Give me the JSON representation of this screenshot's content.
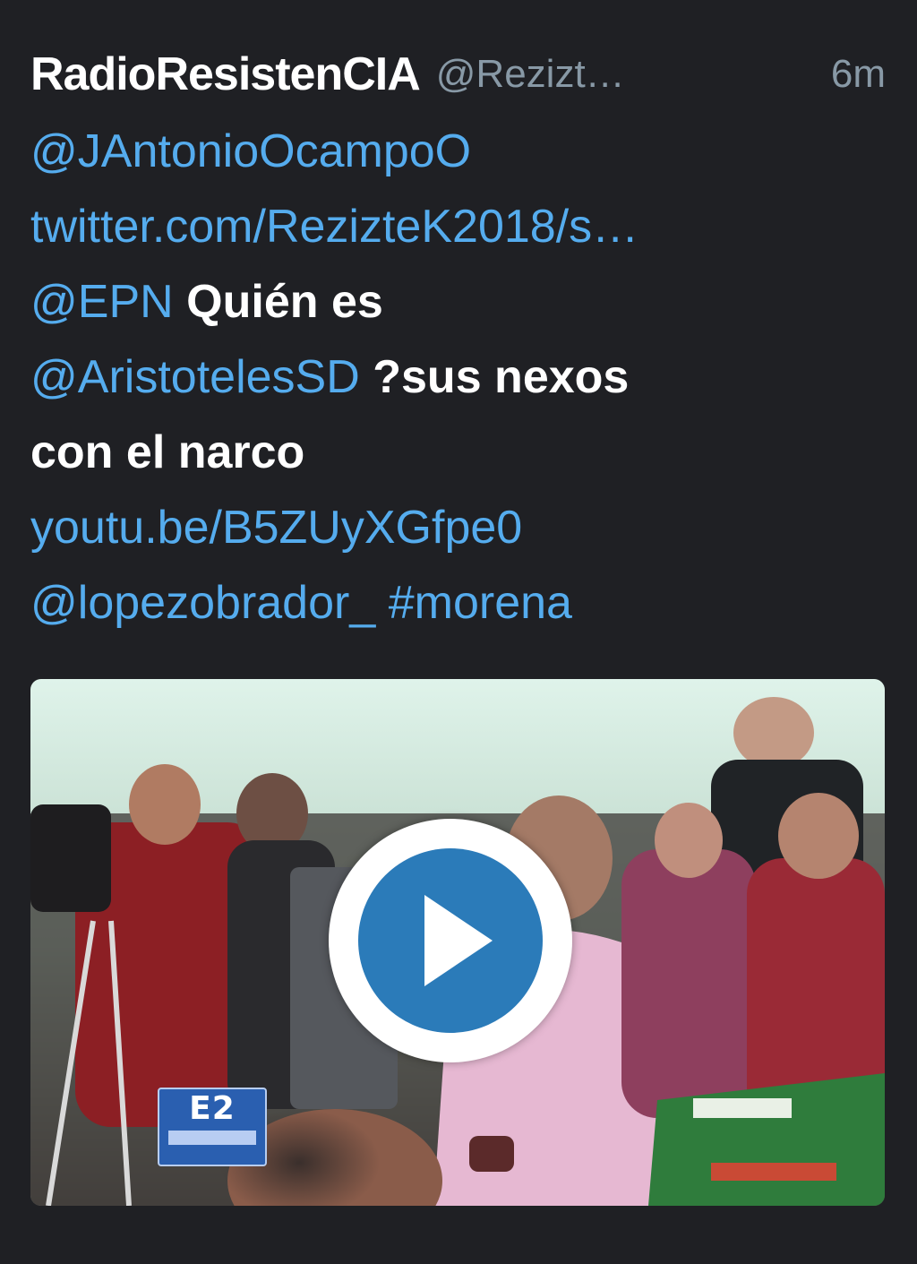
{
  "tweet": {
    "display_name": "RadioResistenCIA",
    "handle": "@Rezizt…",
    "time": "6m",
    "lines": [
      [
        {
          "text": "@JAntonioOcampoO",
          "kind": "link"
        }
      ],
      [
        {
          "text": "twitter.com/RezizteK2018/s…",
          "kind": "link"
        }
      ],
      [
        {
          "text": "@EPN",
          "kind": "link"
        },
        {
          "text": " Quién es",
          "kind": "plain"
        }
      ],
      [
        {
          "text": "@AristotelesSD",
          "kind": "link"
        },
        {
          "text": " ?sus nexos",
          "kind": "plain"
        }
      ],
      [
        {
          "text": "con el narco",
          "kind": "plain"
        }
      ],
      [
        {
          "text": "youtu.be/B5ZUyXGfpe0",
          "kind": "link"
        }
      ],
      [
        {
          "text": "@lopezobrador_",
          "kind": "link"
        },
        {
          "text": " ",
          "kind": "plain"
        },
        {
          "text": "#morena",
          "kind": "link"
        }
      ]
    ],
    "media": {
      "play_icon": "play-icon",
      "logo_text": "E2"
    }
  },
  "colors": {
    "background": "#1f2024",
    "link": "#55acee",
    "muted": "#8899a6",
    "text": "#ffffff",
    "play": "#2b7bb9"
  }
}
